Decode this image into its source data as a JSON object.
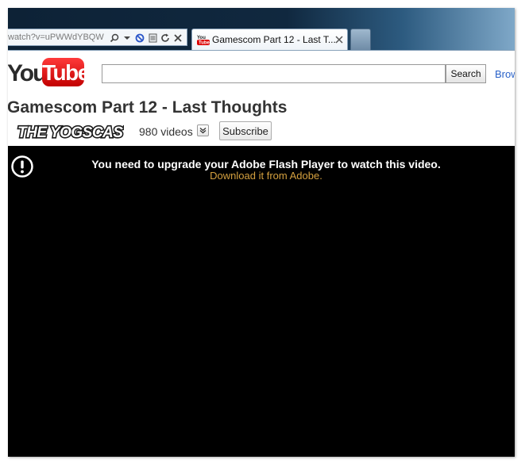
{
  "browser": {
    "address_text": "watch?v=uPWWdYBQW",
    "tab_title": "Gamescom Part 12 - Last T...",
    "icons": [
      "search-icon",
      "dropdown-arrow-icon",
      "blocked-icon",
      "compatibility-icon",
      "refresh-icon",
      "close-icon"
    ]
  },
  "header": {
    "logo_you": "You",
    "logo_tube": "Tube",
    "search_placeholder": "",
    "search_button": "Search",
    "browse_link": "Brow"
  },
  "video": {
    "title": "Gamescom Part 12 - Last Thoughts",
    "channel_logo_text": "THE YOGSCAST",
    "videos_count": "980 videos",
    "subscribe_label": "Subscribe"
  },
  "player": {
    "message": "You need to upgrade your Adobe Flash Player to watch this video.",
    "link": "Download it from Adobe."
  },
  "colors": {
    "youtube_red": "#e00000",
    "player_bg": "#000000",
    "link_orange": "#d4a03f",
    "browse_blue": "#2861c8"
  }
}
